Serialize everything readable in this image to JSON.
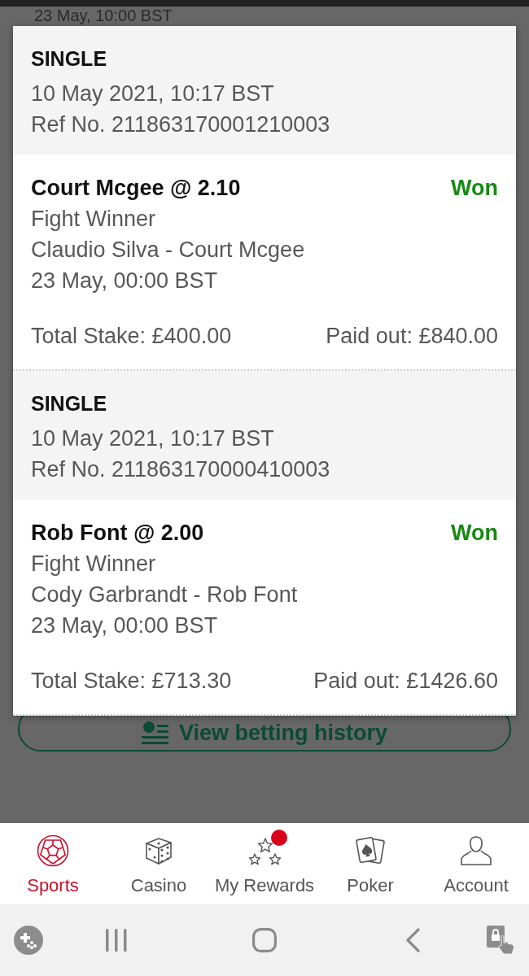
{
  "background_page": {
    "partial_text": "23 May, 10:00 BST",
    "history_button": {
      "label": "View betting history"
    }
  },
  "bet_receipt": {
    "bets": [
      {
        "type": "SINGLE",
        "placed": "10 May 2021, 10:17 BST",
        "ref": "Ref No. 211863170001210003",
        "selection": "Court Mcgee @ 2.10",
        "result": "Won",
        "market": "Fight Winner",
        "event": "Claudio Silva - Court Mcgee",
        "event_time": "23 May, 00:00 BST",
        "stake": "Total Stake: £400.00",
        "payout": "Paid out: £840.00"
      },
      {
        "type": "SINGLE",
        "placed": "10 May 2021, 10:17 BST",
        "ref": "Ref No. 211863170000410003",
        "selection": "Rob Font @ 2.00",
        "result": "Won",
        "market": "Fight Winner",
        "event": "Cody Garbrandt - Rob Font",
        "event_time": "23 May, 00:00 BST",
        "stake": "Total Stake: £713.30",
        "payout": "Paid out: £1426.60"
      }
    ]
  },
  "bottom_nav": {
    "items": [
      {
        "label": "Sports",
        "selected": true,
        "notification": false
      },
      {
        "label": "Casino",
        "selected": false,
        "notification": false
      },
      {
        "label": "My Rewards",
        "selected": false,
        "notification": true
      },
      {
        "label": "Poker",
        "selected": false,
        "notification": false
      },
      {
        "label": "Account",
        "selected": false,
        "notification": false
      }
    ]
  }
}
